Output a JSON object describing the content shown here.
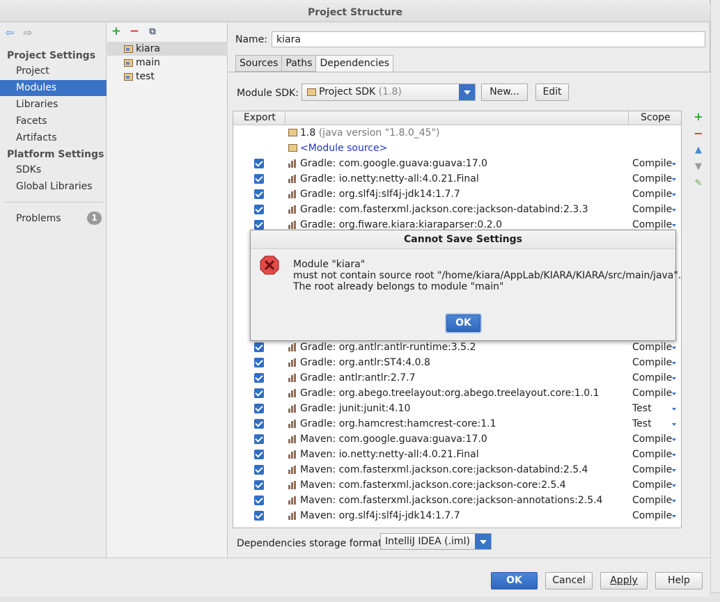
{
  "window": {
    "title": "Project Structure"
  },
  "nav": {
    "sections": [
      {
        "label": "Project Settings",
        "items": [
          "Project",
          "Modules",
          "Libraries",
          "Facets",
          "Artifacts"
        ]
      },
      {
        "label": "Platform Settings",
        "items": [
          "SDKs",
          "Global Libraries"
        ]
      }
    ],
    "selected_item": "Modules",
    "problems": {
      "label": "Problems",
      "count": "1"
    }
  },
  "modules": {
    "items": [
      "kiara",
      "main",
      "test"
    ],
    "selected": "kiara"
  },
  "module_settings": {
    "name_label": "Name:",
    "name_value": "kiara",
    "tabs": [
      "Sources",
      "Paths",
      "Dependencies"
    ],
    "active_tab": "Dependencies",
    "sdk_label": "Module SDK:",
    "sdk_value": "Project SDK",
    "sdk_version": "(1.8)",
    "new_button": "New...",
    "edit_button": "Edit"
  },
  "dependencies": {
    "col_export": "Export",
    "col_scope": "Scope",
    "top_rows": [
      {
        "kind": "sdk",
        "name": "1.8",
        "detail": "(java version \"1.8.0_45\")"
      },
      {
        "kind": "source",
        "name": "<Module source>"
      },
      {
        "kind": "lib",
        "checked": true,
        "name": "Gradle: com.google.guava:guava:17.0",
        "scope": "Compile"
      },
      {
        "kind": "lib",
        "checked": true,
        "name": "Gradle: io.netty:netty-all:4.0.21.Final",
        "scope": "Compile"
      },
      {
        "kind": "lib",
        "checked": true,
        "name": "Gradle: org.slf4j:slf4j-jdk14:1.7.7",
        "scope": "Compile"
      },
      {
        "kind": "lib",
        "checked": true,
        "name": "Gradle: com.fasterxml.jackson.core:jackson-databind:2.3.3",
        "scope": "Compile"
      },
      {
        "kind": "lib",
        "checked": true,
        "name": "Gradle: org.fiware.kiara:kiaraparser:0.2.0",
        "scope": "Compile"
      }
    ],
    "bottom_rows": [
      {
        "kind": "lib",
        "checked": true,
        "name": "Gradle: org.antlr:antlr-runtime:3.5.2",
        "scope": "Compile"
      },
      {
        "kind": "lib",
        "checked": true,
        "name": "Gradle: org.antlr:ST4:4.0.8",
        "scope": "Compile"
      },
      {
        "kind": "lib",
        "checked": true,
        "name": "Gradle: antlr:antlr:2.7.7",
        "scope": "Compile"
      },
      {
        "kind": "lib",
        "checked": true,
        "name": "Gradle: org.abego.treelayout:org.abego.treelayout.core:1.0.1",
        "scope": "Compile"
      },
      {
        "kind": "lib",
        "checked": true,
        "name": "Gradle: junit:junit:4.10",
        "scope": "Test"
      },
      {
        "kind": "lib",
        "checked": true,
        "name": "Gradle: org.hamcrest:hamcrest-core:1.1",
        "scope": "Test"
      },
      {
        "kind": "lib",
        "checked": true,
        "name": "Maven: com.google.guava:guava:17.0",
        "scope": "Compile"
      },
      {
        "kind": "lib",
        "checked": true,
        "name": "Maven: io.netty:netty-all:4.0.21.Final",
        "scope": "Compile"
      },
      {
        "kind": "lib",
        "checked": true,
        "name": "Maven: com.fasterxml.jackson.core:jackson-databind:2.5.4",
        "scope": "Compile"
      },
      {
        "kind": "lib",
        "checked": true,
        "name": "Maven: com.fasterxml.jackson.core:jackson-core:2.5.4",
        "scope": "Compile"
      },
      {
        "kind": "lib",
        "checked": true,
        "name": "Maven: com.fasterxml.jackson.core:jackson-annotations:2.5.4",
        "scope": "Compile"
      },
      {
        "kind": "lib",
        "checked": true,
        "name": "Maven: org.slf4j:slf4j-jdk14:1.7.7",
        "scope": "Compile"
      }
    ],
    "storage_label": "Dependencies storage format:",
    "storage_value": "IntelliJ IDEA (.iml)"
  },
  "buttons": {
    "ok": "OK",
    "cancel": "Cancel",
    "apply": "Apply",
    "help": "Help"
  },
  "dialog": {
    "title": "Cannot Save Settings",
    "lines": [
      "Module \"kiara\"",
      "must not contain source root \"/home/kiara/AppLab/KIARA/KIARA/src/main/java\".",
      "The root already belongs to module \"main\""
    ],
    "ok": "OK"
  },
  "colors": {
    "accent": "#3a73c6",
    "error": "#d03a3a",
    "add": "#3aa13a"
  }
}
